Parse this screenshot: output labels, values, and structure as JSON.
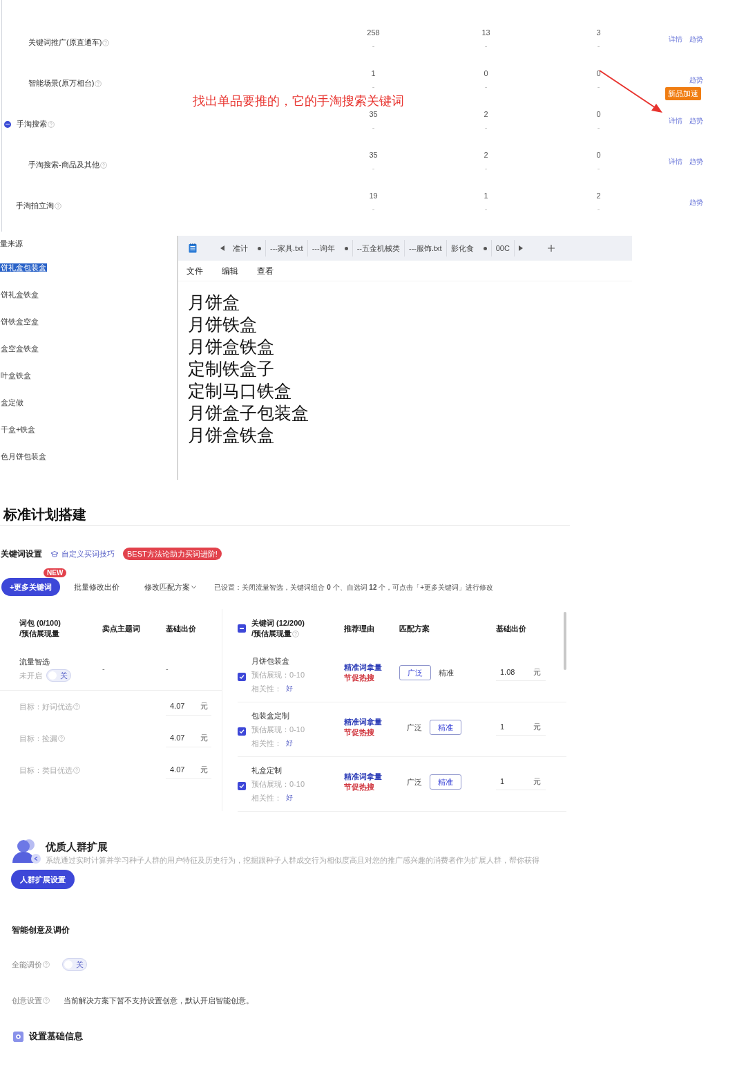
{
  "traffic_table": {
    "rows": [
      {
        "children": [
          {
            "name": "关键词推广(原直通车)",
            "values": [
              "258",
              "13",
              "3"
            ],
            "subs": [
              "-",
              "-",
              "-"
            ],
            "links": [
              "详情",
              "趋势"
            ]
          },
          {
            "name": "智能场景(原万相台)",
            "values": [
              "1",
              "0",
              "0"
            ],
            "subs": [
              "-",
              "-",
              "-"
            ],
            "links": [
              "趋势"
            ],
            "badge": "新品加速"
          }
        ]
      },
      {
        "name": "手淘搜索",
        "expanded": true,
        "values": [
          "35",
          "2",
          "0"
        ],
        "subs": [
          "-",
          "-",
          "-"
        ],
        "links": [
          "详情",
          "趋势"
        ],
        "children": [
          {
            "name": "手淘搜索-商品及其他",
            "values": [
              "35",
              "2",
              "0"
            ],
            "subs": [
              "-",
              "-",
              "-"
            ],
            "links": [
              "详情",
              "趋势"
            ]
          }
        ]
      },
      {
        "name": "手淘拍立淘",
        "values": [
          "19",
          "1",
          "2"
        ],
        "subs": [
          "-",
          "-",
          "-"
        ],
        "links": [
          "趋势"
        ]
      }
    ],
    "annotation": "找出单品要推的，它的手淘搜索关键词"
  },
  "source_list": {
    "title": "量来源",
    "items": [
      {
        "label": "饼礼盒包装盒",
        "selected": true
      },
      {
        "label": "饼礼盒铁盒",
        "selected": false
      },
      {
        "label": "饼铁盒空盒",
        "selected": false
      },
      {
        "label": "盒空盒铁盒",
        "selected": false
      },
      {
        "label": "叶盒铁盒",
        "selected": false
      },
      {
        "label": "盒定做",
        "selected": false
      },
      {
        "label": "干盒+铁盒",
        "selected": false
      },
      {
        "label": "色月饼包装盒",
        "selected": false
      }
    ]
  },
  "notepad": {
    "tabs": [
      {
        "label": "准计",
        "modified": true
      },
      {
        "label": "---家具.txt",
        "modified": false
      },
      {
        "label": "---询年",
        "modified": true
      },
      {
        "label": "--五金机械类",
        "modified": false
      },
      {
        "label": "---服饰.txt",
        "modified": false
      },
      {
        "label": "影化食",
        "modified": true
      },
      {
        "label": "00C",
        "modified": false
      }
    ],
    "menu": [
      "文件",
      "编辑",
      "查看"
    ],
    "lines": [
      "月饼盒",
      "月饼铁盒",
      "月饼盒铁盒",
      "定制铁盒子",
      "定制马口铁盒",
      "月饼盒子包装盒",
      "月饼盒铁盒"
    ]
  },
  "plan": {
    "title": "标准计划搭建",
    "keyword_settings": {
      "title": "关键词设置",
      "tip_link": "自定义买词技巧",
      "promo_badge": "BEST方法论助力买词进阶!"
    },
    "toolbar": {
      "add_button": "+更多关键词",
      "new_badge": "NEW",
      "batch_bid": "批量修改出价",
      "match_dropdown": "修改匹配方案",
      "summary": "已设置：关闭流量智选，关键词组合 **0** 个、自选词 **12** 个，可点击「+更多关键词」进行修改"
    },
    "package_table": {
      "columns": [
        {
          "title": "词包 (0/100)",
          "subtitle": "/预估展现量"
        },
        {
          "title": "卖点主题词"
        },
        {
          "title": "基础出价"
        }
      ],
      "smart_row": {
        "name": "流量智选",
        "status": "未开启",
        "toggle": {
          "on": false,
          "label": "关"
        },
        "cells": [
          "-",
          "-"
        ]
      },
      "goals": [
        {
          "label": "目标：好词优选",
          "price": "4.07",
          "unit": "元"
        },
        {
          "label": "目标：捡漏",
          "price": "4.07",
          "unit": "元"
        },
        {
          "label": "目标：类目优选",
          "price": "4.07",
          "unit": "元"
        }
      ]
    },
    "keyword_table": {
      "select_all_indeterminate": true,
      "columns": [
        {
          "title": "关键词 (12/200)",
          "subtitle": "/预估展现量"
        },
        {
          "title": "推荐理由"
        },
        {
          "title": "匹配方案"
        },
        {
          "title": "基础出价"
        }
      ],
      "rows": [
        {
          "keyword": "月饼包装盒",
          "checked": true,
          "estimate": "预估展现：0-10",
          "relevance_label": "相关性：",
          "relevance": "好",
          "reasons": [
            {
              "text": "精准词拿量",
              "color": "#2f3fb8"
            },
            {
              "text": "节促热搜",
              "color": "#d0343c"
            }
          ],
          "match": [
            {
              "label": "广泛",
              "selected": true
            },
            {
              "label": "精准",
              "selected": false
            }
          ],
          "price": "1.08",
          "unit": "元"
        },
        {
          "keyword": "包装盒定制",
          "checked": true,
          "estimate": "预估展现：0-10",
          "relevance_label": "相关性：",
          "relevance": "好",
          "reasons": [
            {
              "text": "精准词拿量",
              "color": "#2f3fb8"
            },
            {
              "text": "节促热搜",
              "color": "#d0343c"
            }
          ],
          "match": [
            {
              "label": "广泛",
              "selected": false
            },
            {
              "label": "精准",
              "selected": true
            }
          ],
          "price": "1",
          "unit": "元"
        },
        {
          "keyword": "礼盒定制",
          "checked": true,
          "estimate": "预估展现：0-10",
          "relevance_label": "相关性：",
          "relevance": "好",
          "reasons": [
            {
              "text": "精准词拿量",
              "color": "#2f3fb8"
            },
            {
              "text": "节促热搜",
              "color": "#d0343c"
            }
          ],
          "match": [
            {
              "label": "广泛",
              "selected": false
            },
            {
              "label": "精准",
              "selected": true
            }
          ],
          "price": "1",
          "unit": "元"
        }
      ]
    }
  },
  "crowd": {
    "title": "优质人群扩展",
    "description": "系统通过实时计算并学习种子人群的用户特征及历史行为，挖掘跟种子人群成交行为相似度高且对您的推广感兴趣的消费者作为扩展人群，帮你获得",
    "button": "人群扩展设置"
  },
  "smart": {
    "title": "智能创意及调价",
    "price_adjust": {
      "label": "全能调价",
      "toggle": {
        "on": false,
        "label": "关"
      }
    },
    "creative": {
      "label": "创意设置",
      "text": "当前解决方案下暂不支持设置创意，默认开启智能创意。"
    }
  },
  "basic": {
    "title": "设置基础信息"
  }
}
